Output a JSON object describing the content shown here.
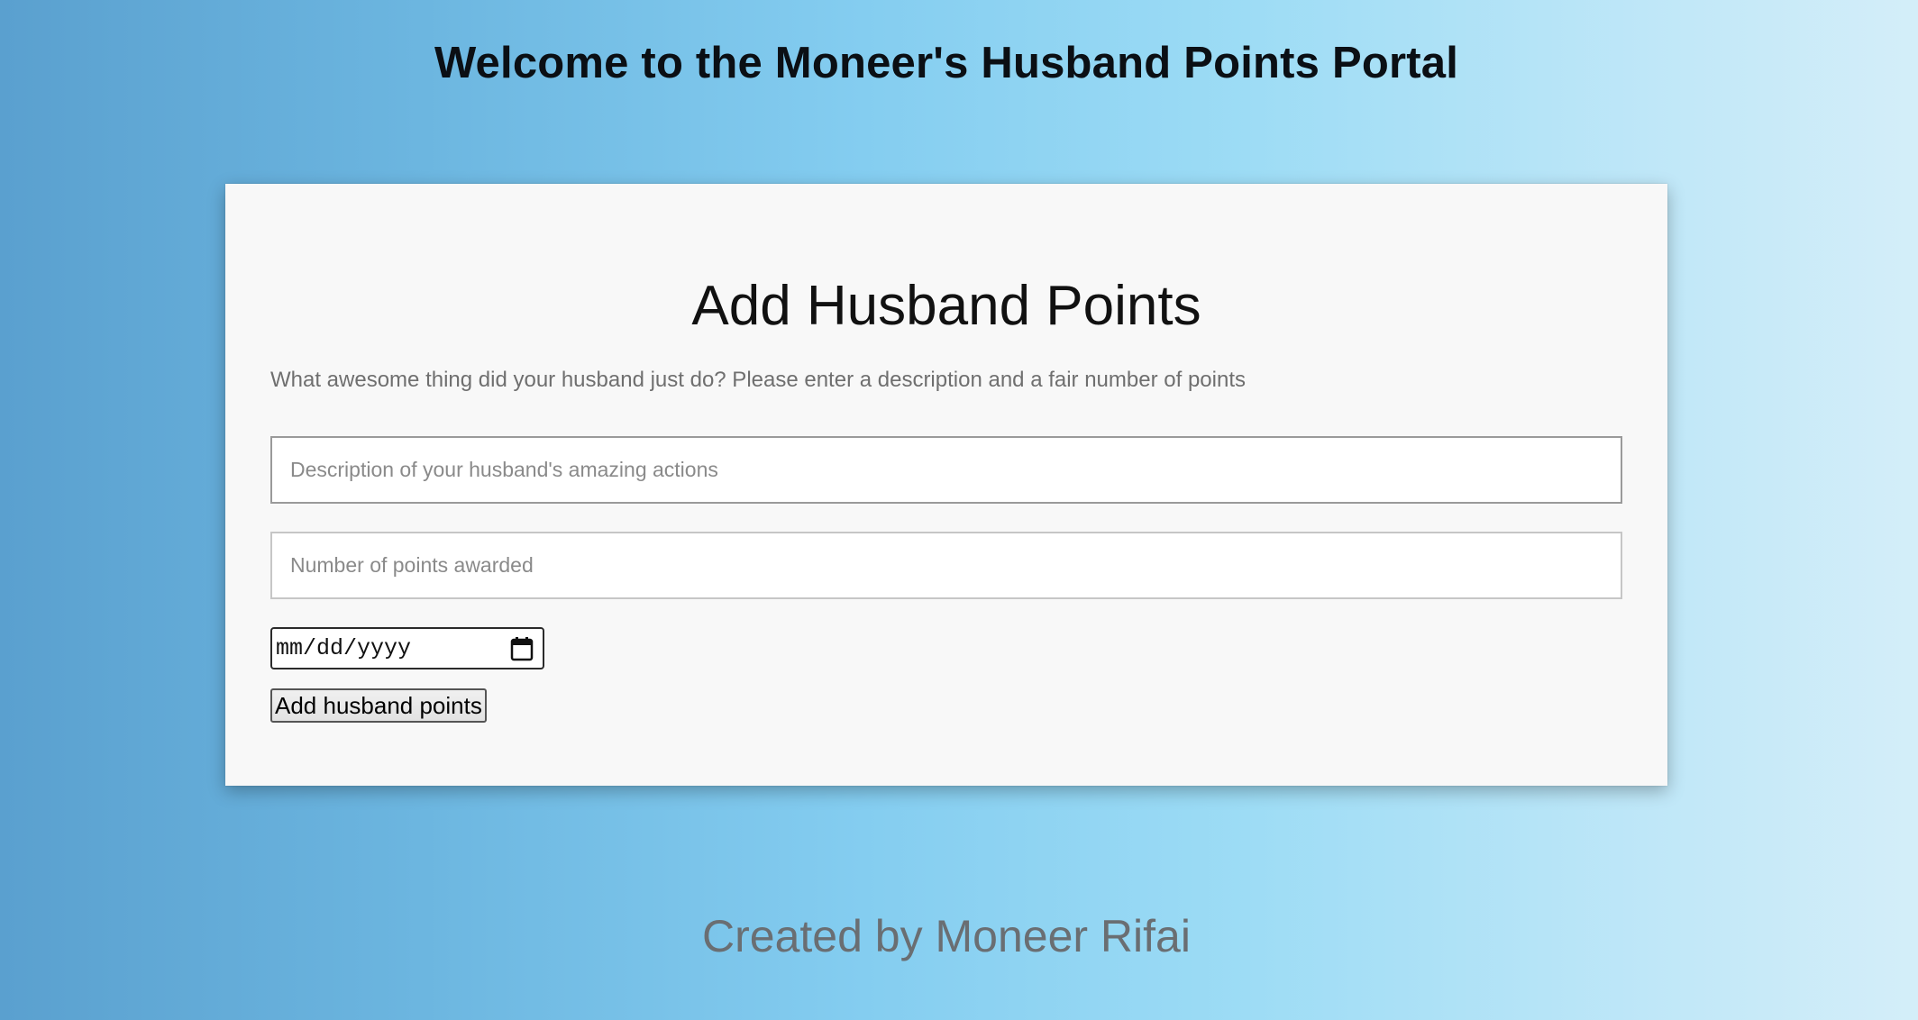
{
  "header": {
    "title": "Welcome to the Moneer's Husband Points Portal"
  },
  "form": {
    "title": "Add Husband Points",
    "description": "What awesome thing did your husband just do? Please enter a description and a fair number of points",
    "description_field": {
      "value": "",
      "placeholder": "Description of your husband's amazing actions"
    },
    "points_field": {
      "value": "",
      "placeholder": "Number of points awarded"
    },
    "date_field": {
      "placeholder": "mm/dd/yyyy",
      "icon": "calendar-icon"
    },
    "submit_label": "Add husband points"
  },
  "footer": {
    "text": "Created by Moneer Rifai"
  }
}
